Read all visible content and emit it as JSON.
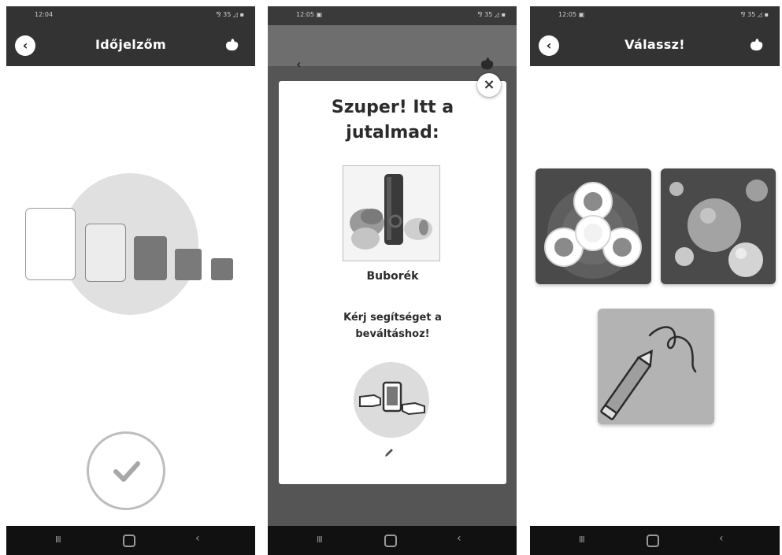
{
  "screens": [
    {
      "status_time": "12:04",
      "status_icons": "⅋ 35 ◿ ▪",
      "back_label": "‹",
      "title": "Időjelzőm",
      "hand_icon": "hand-icon",
      "progress_steps": 5,
      "check_icon": "checkmark-icon"
    },
    {
      "status_time": "12:05 ▣",
      "status_icons": "⅋ 35 ◿ ▪",
      "back_label": "‹",
      "close_label": "×",
      "dialog_title_line1": "Szuper! Itt a",
      "dialog_title_line2": "jutalmad:",
      "reward_name": "Buborék",
      "help_line1": "Kérj segítséget a",
      "help_line2": "beváltáshoz!",
      "exchange_icon": "exchange-icon",
      "edit_icon": "pencil-icon"
    },
    {
      "status_time": "12:05 ▣",
      "status_icons": "⅋ 35 ◿ ▪",
      "back_label": "‹",
      "title": "Válassz!",
      "hand_icon": "hand-icon",
      "choices": [
        "fidget-spinner",
        "bubbles",
        "drawing-pencil"
      ]
    }
  ],
  "navbar": {
    "recent": "III",
    "back": "‹"
  },
  "colors": {
    "appbar": "#333333",
    "navbar": "#111111",
    "tile_dark": "#4a4a4a",
    "tile_light": "#b3b3b3"
  }
}
